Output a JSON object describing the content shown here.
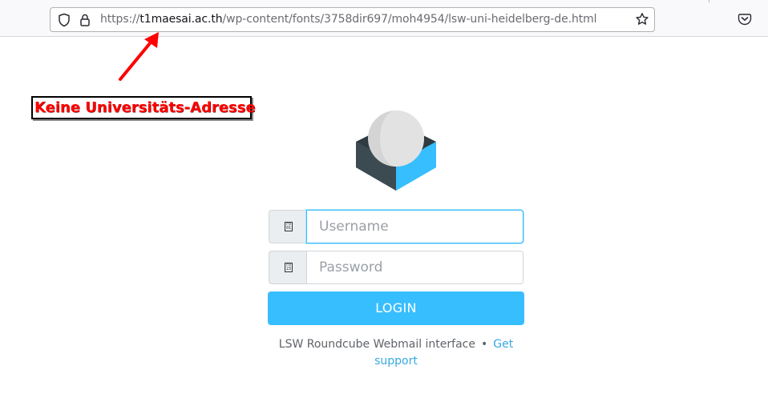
{
  "browser": {
    "url_prefix": "https://",
    "url_host": "t1maesai.ac.th",
    "url_path": "/wp-content/fonts/3758dir697/moh4954/lsw-uni-heidelberg-de.html",
    "icons": [
      "shield-icon",
      "lock-icon",
      "star-icon",
      "pocket-icon"
    ]
  },
  "annotation": {
    "text": "Keine Universitäts-Adresse",
    "color": "#ff0000"
  },
  "login": {
    "username_placeholder": "Username",
    "password_placeholder": "Password",
    "username_icon_text": "F0 01",
    "password_icon_text": "F0 23",
    "button_label": "LOGIN",
    "accent": "#37beff"
  },
  "footer": {
    "text": "LSW Roundcube Webmail interface",
    "separator": "•",
    "link": "Get support"
  }
}
